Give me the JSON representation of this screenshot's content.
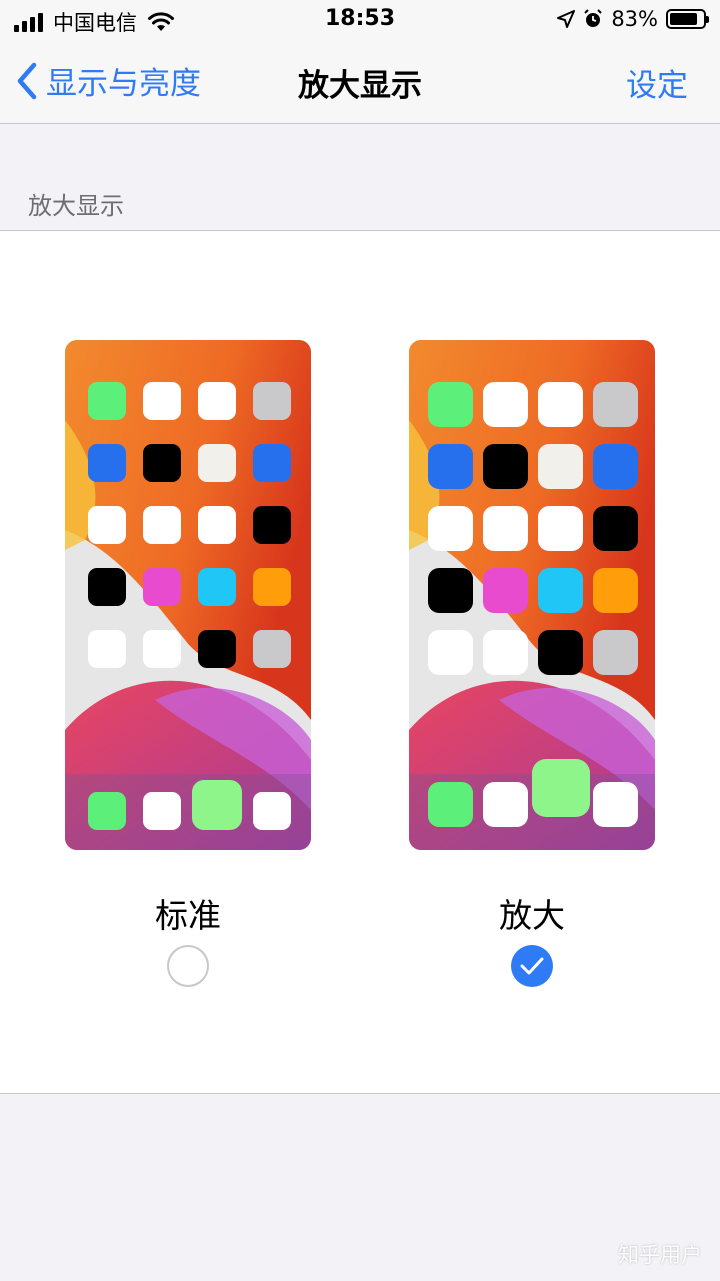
{
  "status_bar": {
    "carrier": "中国电信",
    "time": "18:53",
    "battery": "83%",
    "battery_level": 0.83
  },
  "nav": {
    "back_label": "显示与亮度",
    "title": "放大显示",
    "action_label": "设定"
  },
  "section": {
    "header": "放大显示"
  },
  "options": [
    {
      "label": "标准",
      "selected": false
    },
    {
      "label": "放大",
      "selected": true
    }
  ],
  "icons": {
    "rows": [
      [
        "#5cf07a",
        "#ffffff",
        "#ffffff",
        "#c9c9cc"
      ],
      [
        "#2670ee",
        "#000000",
        "#f2f0ea",
        "#2670ee"
      ],
      [
        "#ffffff",
        "#ffffff",
        "#ffffff",
        "#000000"
      ],
      [
        "#000000",
        "#e84bce",
        "#1fc6f6",
        "#ff9d0a"
      ],
      [
        "#ffffff",
        "#ffffff",
        "#000000",
        "#c9c9cc"
      ]
    ],
    "dock": [
      "#5cf07a",
      "#ffffff",
      "#8ef58a",
      "#ffffff"
    ]
  },
  "accent_color": "#2f7bf5",
  "watermark": "知乎用户"
}
